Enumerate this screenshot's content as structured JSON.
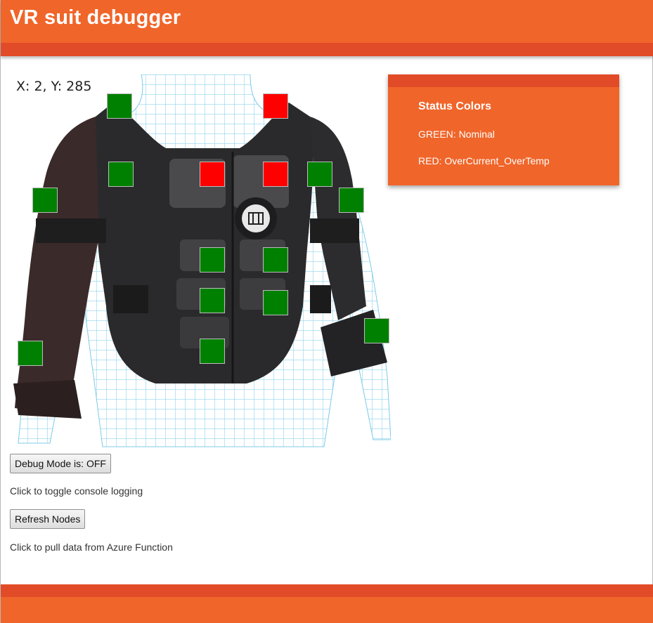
{
  "header": {
    "title": "VR suit debugger"
  },
  "suit": {
    "coords_readout": "X: 2, Y: 285",
    "nodes": [
      {
        "id": "n1",
        "status": "GREEN"
      },
      {
        "id": "n2",
        "status": "RED"
      },
      {
        "id": "n3",
        "status": "GREEN"
      },
      {
        "id": "n4",
        "status": "RED"
      },
      {
        "id": "n5",
        "status": "RED"
      },
      {
        "id": "n6",
        "status": "GREEN"
      },
      {
        "id": "n7",
        "status": "GREEN"
      },
      {
        "id": "n8",
        "status": "GREEN"
      },
      {
        "id": "n9",
        "status": "GREEN"
      },
      {
        "id": "n10",
        "status": "GREEN"
      },
      {
        "id": "n11",
        "status": "GREEN"
      },
      {
        "id": "n12",
        "status": "GREEN"
      },
      {
        "id": "n13",
        "status": "GREEN"
      },
      {
        "id": "n14",
        "status": "GREEN"
      },
      {
        "id": "n15",
        "status": "GREEN"
      }
    ]
  },
  "legend": {
    "title": "Status Colors",
    "green": "GREEN: Nominal",
    "red": "RED: OverCurrent_OverTemp"
  },
  "colors": {
    "GREEN": "#008000",
    "RED": "#ff0000",
    "accent": "#f0652a",
    "accent_dark": "#e24b27"
  },
  "controls": {
    "debug_button": "Debug Mode is: OFF",
    "debug_hint": "Click to toggle console logging",
    "refresh_button": "Refresh Nodes",
    "refresh_hint": "Click to pull data from Azure Function"
  }
}
